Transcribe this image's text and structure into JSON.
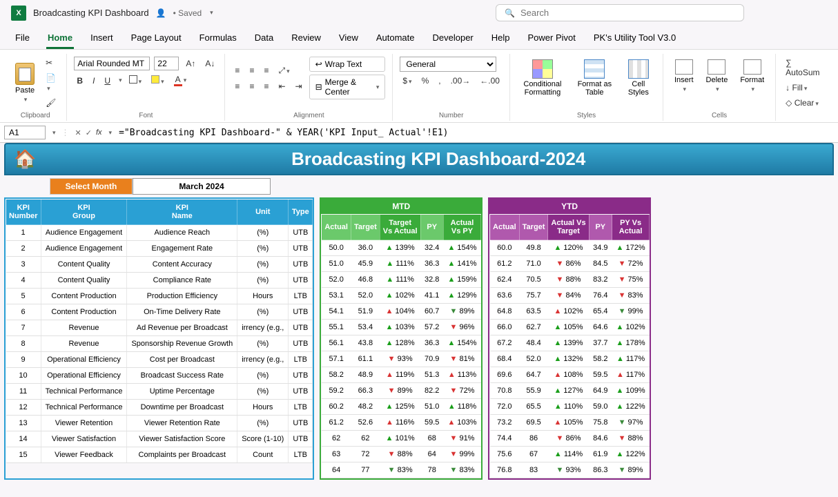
{
  "titlebar": {
    "doc_name": "Broadcasting KPI Dashboard",
    "saved_status": "• Saved",
    "search_placeholder": "Search"
  },
  "ribbon_tabs": [
    "File",
    "Home",
    "Insert",
    "Page Layout",
    "Formulas",
    "Data",
    "Review",
    "View",
    "Automate",
    "Developer",
    "Help",
    "Power Pivot",
    "PK's Utility Tool V3.0"
  ],
  "active_tab_index": 1,
  "ribbon": {
    "clipboard": {
      "paste": "Paste",
      "label": "Clipboard"
    },
    "font": {
      "name": "Arial Rounded MT",
      "size": "22",
      "label": "Font",
      "bold": "B",
      "italic": "I",
      "underline": "U"
    },
    "alignment": {
      "wrap": "Wrap Text",
      "merge": "Merge & Center",
      "label": "Alignment"
    },
    "number": {
      "format": "General",
      "label": "Number"
    },
    "styles": {
      "cond": "Conditional Formatting",
      "table": "Format as Table",
      "cell": "Cell Styles",
      "label": "Styles"
    },
    "cells": {
      "insert": "Insert",
      "delete": "Delete",
      "format": "Format",
      "label": "Cells"
    },
    "editing": {
      "autosum": "AutoSum",
      "fill": "Fill",
      "clear": "Clear"
    }
  },
  "formula_bar": {
    "cell": "A1",
    "formula": "=\"Broadcasting KPI Dashboard-\" & YEAR('KPI Input_ Actual'!E1)"
  },
  "dashboard": {
    "title": "Broadcasting KPI Dashboard-2024",
    "select_month_label": "Select Month",
    "selected_month": "March 2024",
    "blue_headers": [
      "KPI Number",
      "KPI Group",
      "KPI Name",
      "Unit",
      "Type"
    ],
    "mtd_label": "MTD",
    "mtd_headers": [
      "Actual",
      "Target",
      "Target Vs Actual",
      "PY",
      "Actual Vs PY"
    ],
    "ytd_label": "YTD",
    "ytd_headers": [
      "Actual",
      "Target",
      "Actual Vs Target",
      "PY",
      "PY Vs Actual"
    ]
  },
  "kpi_rows": [
    {
      "n": "1",
      "group": "Audience Engagement",
      "name": "Audience Reach",
      "unit": "(%)",
      "type": "UTB"
    },
    {
      "n": "2",
      "group": "Audience Engagement",
      "name": "Engagement Rate",
      "unit": "(%)",
      "type": "UTB"
    },
    {
      "n": "3",
      "group": "Content Quality",
      "name": "Content Accuracy",
      "unit": "(%)",
      "type": "UTB"
    },
    {
      "n": "4",
      "group": "Content Quality",
      "name": "Compliance Rate",
      "unit": "(%)",
      "type": "UTB"
    },
    {
      "n": "5",
      "group": "Content Production",
      "name": "Production Efficiency",
      "unit": "Hours",
      "type": "LTB"
    },
    {
      "n": "6",
      "group": "Content Production",
      "name": "On-Time Delivery Rate",
      "unit": "(%)",
      "type": "UTB"
    },
    {
      "n": "7",
      "group": "Revenue",
      "name": "Ad Revenue per Broadcast",
      "unit": "irrency (e.g.,",
      "type": "UTB"
    },
    {
      "n": "8",
      "group": "Revenue",
      "name": "Sponsorship Revenue Growth",
      "unit": "(%)",
      "type": "UTB"
    },
    {
      "n": "9",
      "group": "Operational Efficiency",
      "name": "Cost per Broadcast",
      "unit": "irrency (e.g.,",
      "type": "LTB"
    },
    {
      "n": "10",
      "group": "Operational Efficiency",
      "name": "Broadcast Success Rate",
      "unit": "(%)",
      "type": "UTB"
    },
    {
      "n": "11",
      "group": "Technical Performance",
      "name": "Uptime Percentage",
      "unit": "(%)",
      "type": "UTB"
    },
    {
      "n": "12",
      "group": "Technical Performance",
      "name": "Downtime per Broadcast",
      "unit": "Hours",
      "type": "LTB"
    },
    {
      "n": "13",
      "group": "Viewer Retention",
      "name": "Viewer Retention Rate",
      "unit": "(%)",
      "type": "UTB"
    },
    {
      "n": "14",
      "group": "Viewer Satisfaction",
      "name": "Viewer Satisfaction Score",
      "unit": "Score (1-10)",
      "type": "UTB"
    },
    {
      "n": "15",
      "group": "Viewer Feedback",
      "name": "Complaints per Broadcast",
      "unit": "Count",
      "type": "LTB"
    }
  ],
  "mtd_rows": [
    {
      "a": "50.0",
      "t": "36.0",
      "tva": "139%",
      "tvad": "ug",
      "py": "32.4",
      "avp": "154%",
      "avpd": "ug"
    },
    {
      "a": "51.0",
      "t": "45.9",
      "tva": "111%",
      "tvad": "ug",
      "py": "36.3",
      "avp": "141%",
      "avpd": "ug"
    },
    {
      "a": "52.0",
      "t": "46.8",
      "tva": "111%",
      "tvad": "ug",
      "py": "32.8",
      "avp": "159%",
      "avpd": "ug"
    },
    {
      "a": "53.1",
      "t": "52.0",
      "tva": "102%",
      "tvad": "ug",
      "py": "41.1",
      "avp": "129%",
      "avpd": "ug"
    },
    {
      "a": "54.1",
      "t": "51.9",
      "tva": "104%",
      "tvad": "ur",
      "py": "60.7",
      "avp": "89%",
      "avpd": "dg"
    },
    {
      "a": "55.1",
      "t": "53.4",
      "tva": "103%",
      "tvad": "ug",
      "py": "57.2",
      "avp": "96%",
      "avpd": "dr"
    },
    {
      "a": "56.1",
      "t": "43.8",
      "tva": "128%",
      "tvad": "ug",
      "py": "36.3",
      "avp": "154%",
      "avpd": "ug"
    },
    {
      "a": "57.1",
      "t": "61.1",
      "tva": "93%",
      "tvad": "dr",
      "py": "70.9",
      "avp": "81%",
      "avpd": "dr"
    },
    {
      "a": "58.2",
      "t": "48.9",
      "tva": "119%",
      "tvad": "ur",
      "py": "51.3",
      "avp": "113%",
      "avpd": "ur"
    },
    {
      "a": "59.2",
      "t": "66.3",
      "tva": "89%",
      "tvad": "dr",
      "py": "82.2",
      "avp": "72%",
      "avpd": "dr"
    },
    {
      "a": "60.2",
      "t": "48.2",
      "tva": "125%",
      "tvad": "ug",
      "py": "51.0",
      "avp": "118%",
      "avpd": "ug"
    },
    {
      "a": "61.2",
      "t": "52.6",
      "tva": "116%",
      "tvad": "ur",
      "py": "59.5",
      "avp": "103%",
      "avpd": "ur"
    },
    {
      "a": "62",
      "t": "62",
      "tva": "101%",
      "tvad": "ug",
      "py": "68",
      "avp": "91%",
      "avpd": "dr"
    },
    {
      "a": "63",
      "t": "72",
      "tva": "88%",
      "tvad": "dr",
      "py": "64",
      "avp": "99%",
      "avpd": "dr"
    },
    {
      "a": "64",
      "t": "77",
      "tva": "83%",
      "tvad": "dg",
      "py": "78",
      "avp": "83%",
      "avpd": "dg"
    }
  ],
  "ytd_rows": [
    {
      "a": "60.0",
      "t": "49.8",
      "tva": "120%",
      "tvad": "ug",
      "py": "34.9",
      "avp": "172%",
      "avpd": "ug"
    },
    {
      "a": "61.2",
      "t": "71.0",
      "tva": "86%",
      "tvad": "dr",
      "py": "84.5",
      "avp": "72%",
      "avpd": "dr"
    },
    {
      "a": "62.4",
      "t": "70.5",
      "tva": "88%",
      "tvad": "dr",
      "py": "83.2",
      "avp": "75%",
      "avpd": "dr"
    },
    {
      "a": "63.6",
      "t": "75.7",
      "tva": "84%",
      "tvad": "dr",
      "py": "76.4",
      "avp": "83%",
      "avpd": "dr"
    },
    {
      "a": "64.8",
      "t": "63.5",
      "tva": "102%",
      "tvad": "ur",
      "py": "65.4",
      "avp": "99%",
      "avpd": "dg"
    },
    {
      "a": "66.0",
      "t": "62.7",
      "tva": "105%",
      "tvad": "ug",
      "py": "64.6",
      "avp": "102%",
      "avpd": "ug"
    },
    {
      "a": "67.2",
      "t": "48.4",
      "tva": "139%",
      "tvad": "ug",
      "py": "37.7",
      "avp": "178%",
      "avpd": "ug"
    },
    {
      "a": "68.4",
      "t": "52.0",
      "tva": "132%",
      "tvad": "ug",
      "py": "58.2",
      "avp": "117%",
      "avpd": "ug"
    },
    {
      "a": "69.6",
      "t": "64.7",
      "tva": "108%",
      "tvad": "ur",
      "py": "59.5",
      "avp": "117%",
      "avpd": "ur"
    },
    {
      "a": "70.8",
      "t": "55.9",
      "tva": "127%",
      "tvad": "ug",
      "py": "64.9",
      "avp": "109%",
      "avpd": "ug"
    },
    {
      "a": "72.0",
      "t": "65.5",
      "tva": "110%",
      "tvad": "ug",
      "py": "59.0",
      "avp": "122%",
      "avpd": "ug"
    },
    {
      "a": "73.2",
      "t": "69.5",
      "tva": "105%",
      "tvad": "ur",
      "py": "75.8",
      "avp": "97%",
      "avpd": "dg"
    },
    {
      "a": "74.4",
      "t": "86",
      "tva": "86%",
      "tvad": "dr",
      "py": "84.6",
      "avp": "88%",
      "avpd": "dr"
    },
    {
      "a": "75.6",
      "t": "67",
      "tva": "114%",
      "tvad": "ug",
      "py": "61.9",
      "avp": "122%",
      "avpd": "ug"
    },
    {
      "a": "76.8",
      "t": "83",
      "tva": "93%",
      "tvad": "dg",
      "py": "86.3",
      "avp": "89%",
      "avpd": "dg"
    }
  ],
  "chart_data": {
    "type": "table",
    "title": "Broadcasting KPI Dashboard-2024",
    "month": "March 2024",
    "columns_blue": [
      "KPI Number",
      "KPI Group",
      "KPI Name",
      "Unit",
      "Type"
    ],
    "columns_mtd": [
      "Actual",
      "Target",
      "Target Vs Actual",
      "PY",
      "Actual Vs PY"
    ],
    "columns_ytd": [
      "Actual",
      "Target",
      "Actual Vs Target",
      "PY",
      "PY Vs Actual"
    ],
    "rows": [
      {
        "KPI Number": 1,
        "KPI Group": "Audience Engagement",
        "KPI Name": "Audience Reach",
        "Unit": "(%)",
        "Type": "UTB",
        "MTD": {
          "Actual": 50.0,
          "Target": 36.0,
          "Target Vs Actual": 139,
          "PY": 32.4,
          "Actual Vs PY": 154
        },
        "YTD": {
          "Actual": 60.0,
          "Target": 49.8,
          "Actual Vs Target": 120,
          "PY": 34.9,
          "PY Vs Actual": 172
        }
      },
      {
        "KPI Number": 2,
        "KPI Group": "Audience Engagement",
        "KPI Name": "Engagement Rate",
        "Unit": "(%)",
        "Type": "UTB",
        "MTD": {
          "Actual": 51.0,
          "Target": 45.9,
          "Target Vs Actual": 111,
          "PY": 36.3,
          "Actual Vs PY": 141
        },
        "YTD": {
          "Actual": 61.2,
          "Target": 71.0,
          "Actual Vs Target": 86,
          "PY": 84.5,
          "PY Vs Actual": 72
        }
      },
      {
        "KPI Number": 3,
        "KPI Group": "Content Quality",
        "KPI Name": "Content Accuracy",
        "Unit": "(%)",
        "Type": "UTB",
        "MTD": {
          "Actual": 52.0,
          "Target": 46.8,
          "Target Vs Actual": 111,
          "PY": 32.8,
          "Actual Vs PY": 159
        },
        "YTD": {
          "Actual": 62.4,
          "Target": 70.5,
          "Actual Vs Target": 88,
          "PY": 83.2,
          "PY Vs Actual": 75
        }
      },
      {
        "KPI Number": 4,
        "KPI Group": "Content Quality",
        "KPI Name": "Compliance Rate",
        "Unit": "(%)",
        "Type": "UTB",
        "MTD": {
          "Actual": 53.1,
          "Target": 52.0,
          "Target Vs Actual": 102,
          "PY": 41.1,
          "Actual Vs PY": 129
        },
        "YTD": {
          "Actual": 63.6,
          "Target": 75.7,
          "Actual Vs Target": 84,
          "PY": 76.4,
          "PY Vs Actual": 83
        }
      },
      {
        "KPI Number": 5,
        "KPI Group": "Content Production",
        "KPI Name": "Production Efficiency",
        "Unit": "Hours",
        "Type": "LTB",
        "MTD": {
          "Actual": 54.1,
          "Target": 51.9,
          "Target Vs Actual": 104,
          "PY": 60.7,
          "Actual Vs PY": 89
        },
        "YTD": {
          "Actual": 64.8,
          "Target": 63.5,
          "Actual Vs Target": 102,
          "PY": 65.4,
          "PY Vs Actual": 99
        }
      },
      {
        "KPI Number": 6,
        "KPI Group": "Content Production",
        "KPI Name": "On-Time Delivery Rate",
        "Unit": "(%)",
        "Type": "UTB",
        "MTD": {
          "Actual": 55.1,
          "Target": 53.4,
          "Target Vs Actual": 103,
          "PY": 57.2,
          "Actual Vs PY": 96
        },
        "YTD": {
          "Actual": 66.0,
          "Target": 62.7,
          "Actual Vs Target": 105,
          "PY": 64.6,
          "PY Vs Actual": 102
        }
      },
      {
        "KPI Number": 7,
        "KPI Group": "Revenue",
        "KPI Name": "Ad Revenue per Broadcast",
        "Unit": "irrency (e.g.,",
        "Type": "UTB",
        "MTD": {
          "Actual": 56.1,
          "Target": 43.8,
          "Target Vs Actual": 128,
          "PY": 36.3,
          "Actual Vs PY": 154
        },
        "YTD": {
          "Actual": 67.2,
          "Target": 48.4,
          "Actual Vs Target": 139,
          "PY": 37.7,
          "PY Vs Actual": 178
        }
      },
      {
        "KPI Number": 8,
        "KPI Group": "Revenue",
        "KPI Name": "Sponsorship Revenue Growth",
        "Unit": "(%)",
        "Type": "UTB",
        "MTD": {
          "Actual": 57.1,
          "Target": 61.1,
          "Target Vs Actual": 93,
          "PY": 70.9,
          "Actual Vs PY": 81
        },
        "YTD": {
          "Actual": 68.4,
          "Target": 52.0,
          "Actual Vs Target": 132,
          "PY": 58.2,
          "PY Vs Actual": 117
        }
      },
      {
        "KPI Number": 9,
        "KPI Group": "Operational Efficiency",
        "KPI Name": "Cost per Broadcast",
        "Unit": "irrency (e.g.,",
        "Type": "LTB",
        "MTD": {
          "Actual": 58.2,
          "Target": 48.9,
          "Target Vs Actual": 119,
          "PY": 51.3,
          "Actual Vs PY": 113
        },
        "YTD": {
          "Actual": 69.6,
          "Target": 64.7,
          "Actual Vs Target": 108,
          "PY": 59.5,
          "PY Vs Actual": 117
        }
      },
      {
        "KPI Number": 10,
        "KPI Group": "Operational Efficiency",
        "KPI Name": "Broadcast Success Rate",
        "Unit": "(%)",
        "Type": "UTB",
        "MTD": {
          "Actual": 59.2,
          "Target": 66.3,
          "Target Vs Actual": 89,
          "PY": 82.2,
          "Actual Vs PY": 72
        },
        "YTD": {
          "Actual": 70.8,
          "Target": 55.9,
          "Actual Vs Target": 127,
          "PY": 64.9,
          "PY Vs Actual": 109
        }
      },
      {
        "KPI Number": 11,
        "KPI Group": "Technical Performance",
        "KPI Name": "Uptime Percentage",
        "Unit": "(%)",
        "Type": "UTB",
        "MTD": {
          "Actual": 60.2,
          "Target": 48.2,
          "Target Vs Actual": 125,
          "PY": 51.0,
          "Actual Vs PY": 118
        },
        "YTD": {
          "Actual": 72.0,
          "Target": 65.5,
          "Actual Vs Target": 110,
          "PY": 59.0,
          "PY Vs Actual": 122
        }
      },
      {
        "KPI Number": 12,
        "KPI Group": "Technical Performance",
        "KPI Name": "Downtime per Broadcast",
        "Unit": "Hours",
        "Type": "LTB",
        "MTD": {
          "Actual": 61.2,
          "Target": 52.6,
          "Target Vs Actual": 116,
          "PY": 59.5,
          "Actual Vs PY": 103
        },
        "YTD": {
          "Actual": 73.2,
          "Target": 69.5,
          "Actual Vs Target": 105,
          "PY": 75.8,
          "PY Vs Actual": 97
        }
      },
      {
        "KPI Number": 13,
        "KPI Group": "Viewer Retention",
        "KPI Name": "Viewer Retention Rate",
        "Unit": "(%)",
        "Type": "UTB",
        "MTD": {
          "Actual": 62,
          "Target": 62,
          "Target Vs Actual": 101,
          "PY": 68,
          "Actual Vs PY": 91
        },
        "YTD": {
          "Actual": 74.4,
          "Target": 86,
          "Actual Vs Target": 86,
          "PY": 84.6,
          "PY Vs Actual": 88
        }
      },
      {
        "KPI Number": 14,
        "KPI Group": "Viewer Satisfaction",
        "KPI Name": "Viewer Satisfaction Score",
        "Unit": "Score (1-10)",
        "Type": "UTB",
        "MTD": {
          "Actual": 63,
          "Target": 72,
          "Target Vs Actual": 88,
          "PY": 64,
          "Actual Vs PY": 99
        },
        "YTD": {
          "Actual": 75.6,
          "Target": 67,
          "Actual Vs Target": 114,
          "PY": 61.9,
          "PY Vs Actual": 122
        }
      },
      {
        "KPI Number": 15,
        "KPI Group": "Viewer Feedback",
        "KPI Name": "Complaints per Broadcast",
        "Unit": "Count",
        "Type": "LTB",
        "MTD": {
          "Actual": 64,
          "Target": 77,
          "Target Vs Actual": 83,
          "PY": 78,
          "Actual Vs PY": 83
        },
        "YTD": {
          "Actual": 76.8,
          "Target": 83,
          "Actual Vs Target": 93,
          "PY": 86.3,
          "PY Vs Actual": 89
        }
      }
    ]
  }
}
